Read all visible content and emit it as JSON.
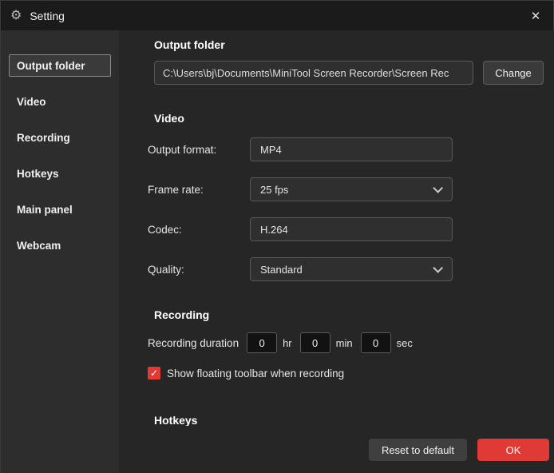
{
  "titlebar": {
    "title": "Setting",
    "gear_icon": "⚙",
    "close_icon": "✕"
  },
  "sidebar": {
    "selected_index": 0,
    "items": [
      {
        "label": "Output folder"
      },
      {
        "label": "Video"
      },
      {
        "label": "Recording"
      },
      {
        "label": "Hotkeys"
      },
      {
        "label": "Main panel"
      },
      {
        "label": "Webcam"
      }
    ]
  },
  "sections": {
    "output_folder": {
      "title": "Output folder",
      "path": "C:\\Users\\bj\\Documents\\MiniTool Screen Recorder\\Screen Rec",
      "change_button": "Change"
    },
    "video": {
      "title": "Video",
      "output_format_label": "Output format:",
      "output_format_value": "MP4",
      "frame_rate_label": "Frame rate:",
      "frame_rate_value": "25 fps",
      "codec_label": "Codec:",
      "codec_value": "H.264",
      "quality_label": "Quality:",
      "quality_value": "Standard"
    },
    "recording": {
      "title": "Recording",
      "duration_label": "Recording duration",
      "hours": "0",
      "hours_unit": "hr",
      "minutes": "0",
      "minutes_unit": "min",
      "seconds": "0",
      "seconds_unit": "sec",
      "checkbox_checked": true,
      "checkbox_label": "Show floating toolbar when recording"
    },
    "hotkeys": {
      "title": "Hotkeys"
    }
  },
  "footer": {
    "reset_button": "Reset to default",
    "ok_button": "OK"
  },
  "icons": {
    "check": "✓"
  },
  "colors": {
    "accent_red": "#e03a36",
    "titlebar_bg": "#1b1b1b",
    "sidebar_bg": "#2d2d2d",
    "content_bg": "#262626",
    "field_bg": "#2f2f2f",
    "field_border": "#5a5a5a"
  }
}
